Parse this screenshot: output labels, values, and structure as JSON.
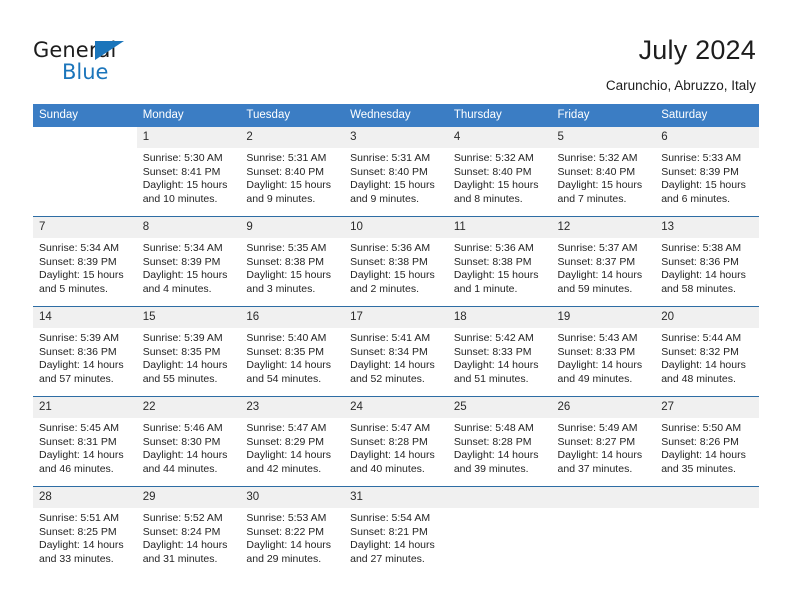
{
  "brand": {
    "name_part1": "General",
    "name_part2": "Blue",
    "triangle_color": "#1b75bb"
  },
  "header": {
    "title": "July 2024",
    "location": "Carunchio, Abruzzo, Italy"
  },
  "colors": {
    "header_blue": "#3b7dc4",
    "row_divider_blue": "#2e6da4",
    "daynum_band": "#f0f0f0"
  },
  "weekday_headers": [
    "Sunday",
    "Monday",
    "Tuesday",
    "Wednesday",
    "Thursday",
    "Friday",
    "Saturday"
  ],
  "weeks": [
    [
      {
        "day": "",
        "blank": true
      },
      {
        "day": "1",
        "sunrise": "Sunrise: 5:30 AM",
        "sunset": "Sunset: 8:41 PM",
        "daylight1": "Daylight: 15 hours",
        "daylight2": "and 10 minutes."
      },
      {
        "day": "2",
        "sunrise": "Sunrise: 5:31 AM",
        "sunset": "Sunset: 8:40 PM",
        "daylight1": "Daylight: 15 hours",
        "daylight2": "and 9 minutes."
      },
      {
        "day": "3",
        "sunrise": "Sunrise: 5:31 AM",
        "sunset": "Sunset: 8:40 PM",
        "daylight1": "Daylight: 15 hours",
        "daylight2": "and 9 minutes."
      },
      {
        "day": "4",
        "sunrise": "Sunrise: 5:32 AM",
        "sunset": "Sunset: 8:40 PM",
        "daylight1": "Daylight: 15 hours",
        "daylight2": "and 8 minutes."
      },
      {
        "day": "5",
        "sunrise": "Sunrise: 5:32 AM",
        "sunset": "Sunset: 8:40 PM",
        "daylight1": "Daylight: 15 hours",
        "daylight2": "and 7 minutes."
      },
      {
        "day": "6",
        "sunrise": "Sunrise: 5:33 AM",
        "sunset": "Sunset: 8:39 PM",
        "daylight1": "Daylight: 15 hours",
        "daylight2": "and 6 minutes."
      }
    ],
    [
      {
        "day": "7",
        "sunrise": "Sunrise: 5:34 AM",
        "sunset": "Sunset: 8:39 PM",
        "daylight1": "Daylight: 15 hours",
        "daylight2": "and 5 minutes."
      },
      {
        "day": "8",
        "sunrise": "Sunrise: 5:34 AM",
        "sunset": "Sunset: 8:39 PM",
        "daylight1": "Daylight: 15 hours",
        "daylight2": "and 4 minutes."
      },
      {
        "day": "9",
        "sunrise": "Sunrise: 5:35 AM",
        "sunset": "Sunset: 8:38 PM",
        "daylight1": "Daylight: 15 hours",
        "daylight2": "and 3 minutes."
      },
      {
        "day": "10",
        "sunrise": "Sunrise: 5:36 AM",
        "sunset": "Sunset: 8:38 PM",
        "daylight1": "Daylight: 15 hours",
        "daylight2": "and 2 minutes."
      },
      {
        "day": "11",
        "sunrise": "Sunrise: 5:36 AM",
        "sunset": "Sunset: 8:38 PM",
        "daylight1": "Daylight: 15 hours",
        "daylight2": "and 1 minute."
      },
      {
        "day": "12",
        "sunrise": "Sunrise: 5:37 AM",
        "sunset": "Sunset: 8:37 PM",
        "daylight1": "Daylight: 14 hours",
        "daylight2": "and 59 minutes."
      },
      {
        "day": "13",
        "sunrise": "Sunrise: 5:38 AM",
        "sunset": "Sunset: 8:36 PM",
        "daylight1": "Daylight: 14 hours",
        "daylight2": "and 58 minutes."
      }
    ],
    [
      {
        "day": "14",
        "sunrise": "Sunrise: 5:39 AM",
        "sunset": "Sunset: 8:36 PM",
        "daylight1": "Daylight: 14 hours",
        "daylight2": "and 57 minutes."
      },
      {
        "day": "15",
        "sunrise": "Sunrise: 5:39 AM",
        "sunset": "Sunset: 8:35 PM",
        "daylight1": "Daylight: 14 hours",
        "daylight2": "and 55 minutes."
      },
      {
        "day": "16",
        "sunrise": "Sunrise: 5:40 AM",
        "sunset": "Sunset: 8:35 PM",
        "daylight1": "Daylight: 14 hours",
        "daylight2": "and 54 minutes."
      },
      {
        "day": "17",
        "sunrise": "Sunrise: 5:41 AM",
        "sunset": "Sunset: 8:34 PM",
        "daylight1": "Daylight: 14 hours",
        "daylight2": "and 52 minutes."
      },
      {
        "day": "18",
        "sunrise": "Sunrise: 5:42 AM",
        "sunset": "Sunset: 8:33 PM",
        "daylight1": "Daylight: 14 hours",
        "daylight2": "and 51 minutes."
      },
      {
        "day": "19",
        "sunrise": "Sunrise: 5:43 AM",
        "sunset": "Sunset: 8:33 PM",
        "daylight1": "Daylight: 14 hours",
        "daylight2": "and 49 minutes."
      },
      {
        "day": "20",
        "sunrise": "Sunrise: 5:44 AM",
        "sunset": "Sunset: 8:32 PM",
        "daylight1": "Daylight: 14 hours",
        "daylight2": "and 48 minutes."
      }
    ],
    [
      {
        "day": "21",
        "sunrise": "Sunrise: 5:45 AM",
        "sunset": "Sunset: 8:31 PM",
        "daylight1": "Daylight: 14 hours",
        "daylight2": "and 46 minutes."
      },
      {
        "day": "22",
        "sunrise": "Sunrise: 5:46 AM",
        "sunset": "Sunset: 8:30 PM",
        "daylight1": "Daylight: 14 hours",
        "daylight2": "and 44 minutes."
      },
      {
        "day": "23",
        "sunrise": "Sunrise: 5:47 AM",
        "sunset": "Sunset: 8:29 PM",
        "daylight1": "Daylight: 14 hours",
        "daylight2": "and 42 minutes."
      },
      {
        "day": "24",
        "sunrise": "Sunrise: 5:47 AM",
        "sunset": "Sunset: 8:28 PM",
        "daylight1": "Daylight: 14 hours",
        "daylight2": "and 40 minutes."
      },
      {
        "day": "25",
        "sunrise": "Sunrise: 5:48 AM",
        "sunset": "Sunset: 8:28 PM",
        "daylight1": "Daylight: 14 hours",
        "daylight2": "and 39 minutes."
      },
      {
        "day": "26",
        "sunrise": "Sunrise: 5:49 AM",
        "sunset": "Sunset: 8:27 PM",
        "daylight1": "Daylight: 14 hours",
        "daylight2": "and 37 minutes."
      },
      {
        "day": "27",
        "sunrise": "Sunrise: 5:50 AM",
        "sunset": "Sunset: 8:26 PM",
        "daylight1": "Daylight: 14 hours",
        "daylight2": "and 35 minutes."
      }
    ],
    [
      {
        "day": "28",
        "sunrise": "Sunrise: 5:51 AM",
        "sunset": "Sunset: 8:25 PM",
        "daylight1": "Daylight: 14 hours",
        "daylight2": "and 33 minutes."
      },
      {
        "day": "29",
        "sunrise": "Sunrise: 5:52 AM",
        "sunset": "Sunset: 8:24 PM",
        "daylight1": "Daylight: 14 hours",
        "daylight2": "and 31 minutes."
      },
      {
        "day": "30",
        "sunrise": "Sunrise: 5:53 AM",
        "sunset": "Sunset: 8:22 PM",
        "daylight1": "Daylight: 14 hours",
        "daylight2": "and 29 minutes."
      },
      {
        "day": "31",
        "sunrise": "Sunrise: 5:54 AM",
        "sunset": "Sunset: 8:21 PM",
        "daylight1": "Daylight: 14 hours",
        "daylight2": "and 27 minutes."
      },
      {
        "day": "",
        "empty_band": true
      },
      {
        "day": "",
        "empty_band": true
      },
      {
        "day": "",
        "empty_band": true
      }
    ]
  ]
}
